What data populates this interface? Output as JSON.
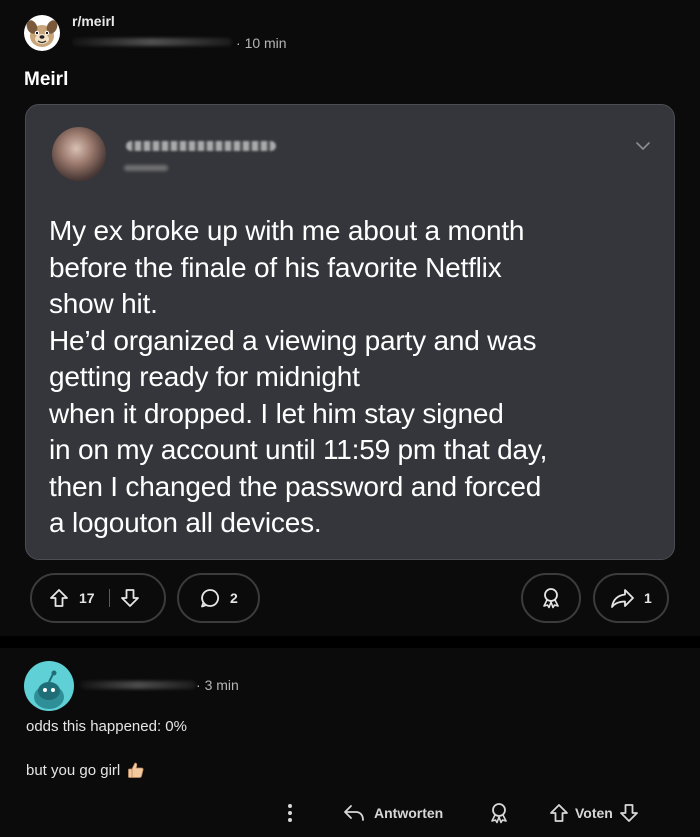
{
  "post": {
    "subreddit": "r/meirl",
    "time": "10 min",
    "title": "Meirl",
    "tweet_lines": [
      "My ex broke up with me about a month",
      "before the finale of his favorite Netflix",
      "show hit.",
      "He’d organized a viewing party and was",
      "getting ready for midnight",
      "when it dropped. I let him stay signed",
      "in on my account until 11:59 pm that day,",
      "then I changed the password and forced",
      "a logouton all devices."
    ],
    "upvotes": "17",
    "comments": "2",
    "shares": "1"
  },
  "comment": {
    "time": "3 min",
    "line1": "odds this happened: 0%",
    "line2": "but you go girl",
    "reply_label": "Antworten",
    "vote_label": "Voten"
  },
  "colors": {
    "background": "#0b0b0b",
    "card": "#34363b",
    "avatar_teal": "#5fd1d6"
  }
}
